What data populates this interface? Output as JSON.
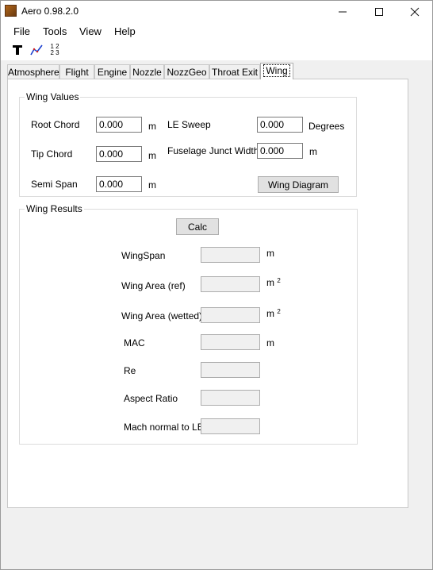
{
  "window": {
    "title": "Aero 0.98.2.0"
  },
  "menu": [
    "File",
    "Tools",
    "View",
    "Help"
  ],
  "tabs": [
    "Atmosphere",
    "Flight",
    "Engine",
    "Nozzle",
    "NozzGeo",
    "Throat Exit",
    "Wing"
  ],
  "active_tab": "Wing",
  "wing_values": {
    "group_label": "Wing Values",
    "root_chord": {
      "label": "Root Chord",
      "value": "0.000",
      "unit": "m"
    },
    "tip_chord": {
      "label": "Tip Chord",
      "value": "0.000",
      "unit": "m"
    },
    "semi_span": {
      "label": "Semi Span",
      "value": "0.000",
      "unit": "m"
    },
    "le_sweep": {
      "label": "LE Sweep",
      "value": "0.000",
      "unit": "Degrees"
    },
    "fuselage_junct_width": {
      "label": "Fuselage Junct Width",
      "value": "0.000",
      "unit": "m"
    },
    "diagram_button": "Wing Diagram"
  },
  "wing_results": {
    "group_label": "Wing Results",
    "calc_button": "Calc",
    "wingspan": {
      "label": "WingSpan",
      "unit": "m"
    },
    "wing_area_ref": {
      "label": "Wing Area (ref)",
      "unit": "m",
      "unit_sup": "2"
    },
    "wing_area_wetted": {
      "label": "Wing Area (wetted)",
      "unit": "m",
      "unit_sup": "2"
    },
    "mac": {
      "label": "MAC",
      "unit": "m"
    },
    "re": {
      "label": "Re"
    },
    "aspect_ratio": {
      "label": "Aspect Ratio"
    },
    "mach_normal": {
      "label": "Mach normal to LE"
    }
  },
  "toolbar_icons": [
    "text-tool-icon",
    "graph-line-icon",
    "number-grid-icon"
  ],
  "toolbar_grid_text": {
    "row1": "1 2",
    "row2": "2 3"
  },
  "window_controls": {
    "minimize": "—",
    "maximize": "☐",
    "close": "✕"
  }
}
